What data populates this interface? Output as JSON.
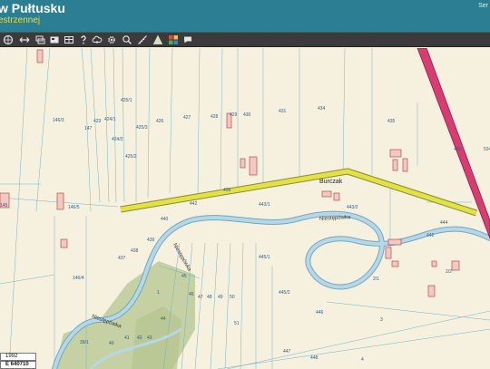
{
  "header": {
    "title": "w Pułtusku",
    "subtitle": "estrzennej",
    "right_label": "Ser"
  },
  "toolbar": {
    "tools": [
      {
        "name": "zoom-extent-tool",
        "icon": "globe-icon"
      },
      {
        "name": "fit-width-tool",
        "icon": "fit-width-icon"
      },
      {
        "name": "layers-tool",
        "icon": "layers-icon"
      },
      {
        "name": "select-tool",
        "icon": "select-icon"
      },
      {
        "name": "table-tool",
        "icon": "table-icon"
      },
      {
        "name": "print-tool",
        "icon": "printer-icon"
      },
      {
        "name": "help-tool",
        "icon": "help-icon"
      },
      {
        "name": "cloud-tool",
        "icon": "cloud-icon"
      },
      {
        "name": "settings-tool",
        "icon": "gear-icon"
      },
      {
        "name": "search-tool",
        "icon": "search-icon"
      },
      {
        "name": "measure-tool",
        "icon": "measure-icon"
      },
      {
        "name": "draw-tool",
        "icon": "triangle-icon"
      },
      {
        "name": "color-tool",
        "icon": "color-grid-icon"
      },
      {
        "name": "comment-tool",
        "icon": "speech-bubble-icon"
      }
    ]
  },
  "map": {
    "place_name": "Burczak",
    "river_labels": [
      "Niestępówka",
      "Niestępówka",
      "Niestępówka"
    ],
    "parcels": [
      "425/1",
      "146/3",
      "147",
      "423",
      "424/1",
      "425/3",
      "426",
      "427",
      "428",
      "429",
      "430",
      "431",
      "434",
      "435",
      "424/2",
      "425/2",
      "145",
      "146/5",
      "436",
      "442",
      "443/1",
      "443/2",
      "440",
      "439",
      "437",
      "146/4",
      "438",
      "444",
      "445/1",
      "445/2",
      "45",
      "46",
      "47",
      "48",
      "49",
      "50",
      "44",
      "1",
      "43",
      "42",
      "41",
      "40",
      "39/1",
      "51",
      "446",
      "2/1",
      "2/2",
      "3",
      "4",
      "447",
      "448",
      "455",
      "534",
      "442"
    ]
  },
  "status": {
    "scale": "1992",
    "coordinate": "E 640710"
  },
  "colors": {
    "header_bg": "#2c7f92",
    "toolbar_bg": "#3b3b3b",
    "map_bg": "#f6f1df",
    "river": "#9ec3d6",
    "road_highlight": "#e3e245",
    "main_road": "#d93b73",
    "forest": "#c5d1a3"
  }
}
